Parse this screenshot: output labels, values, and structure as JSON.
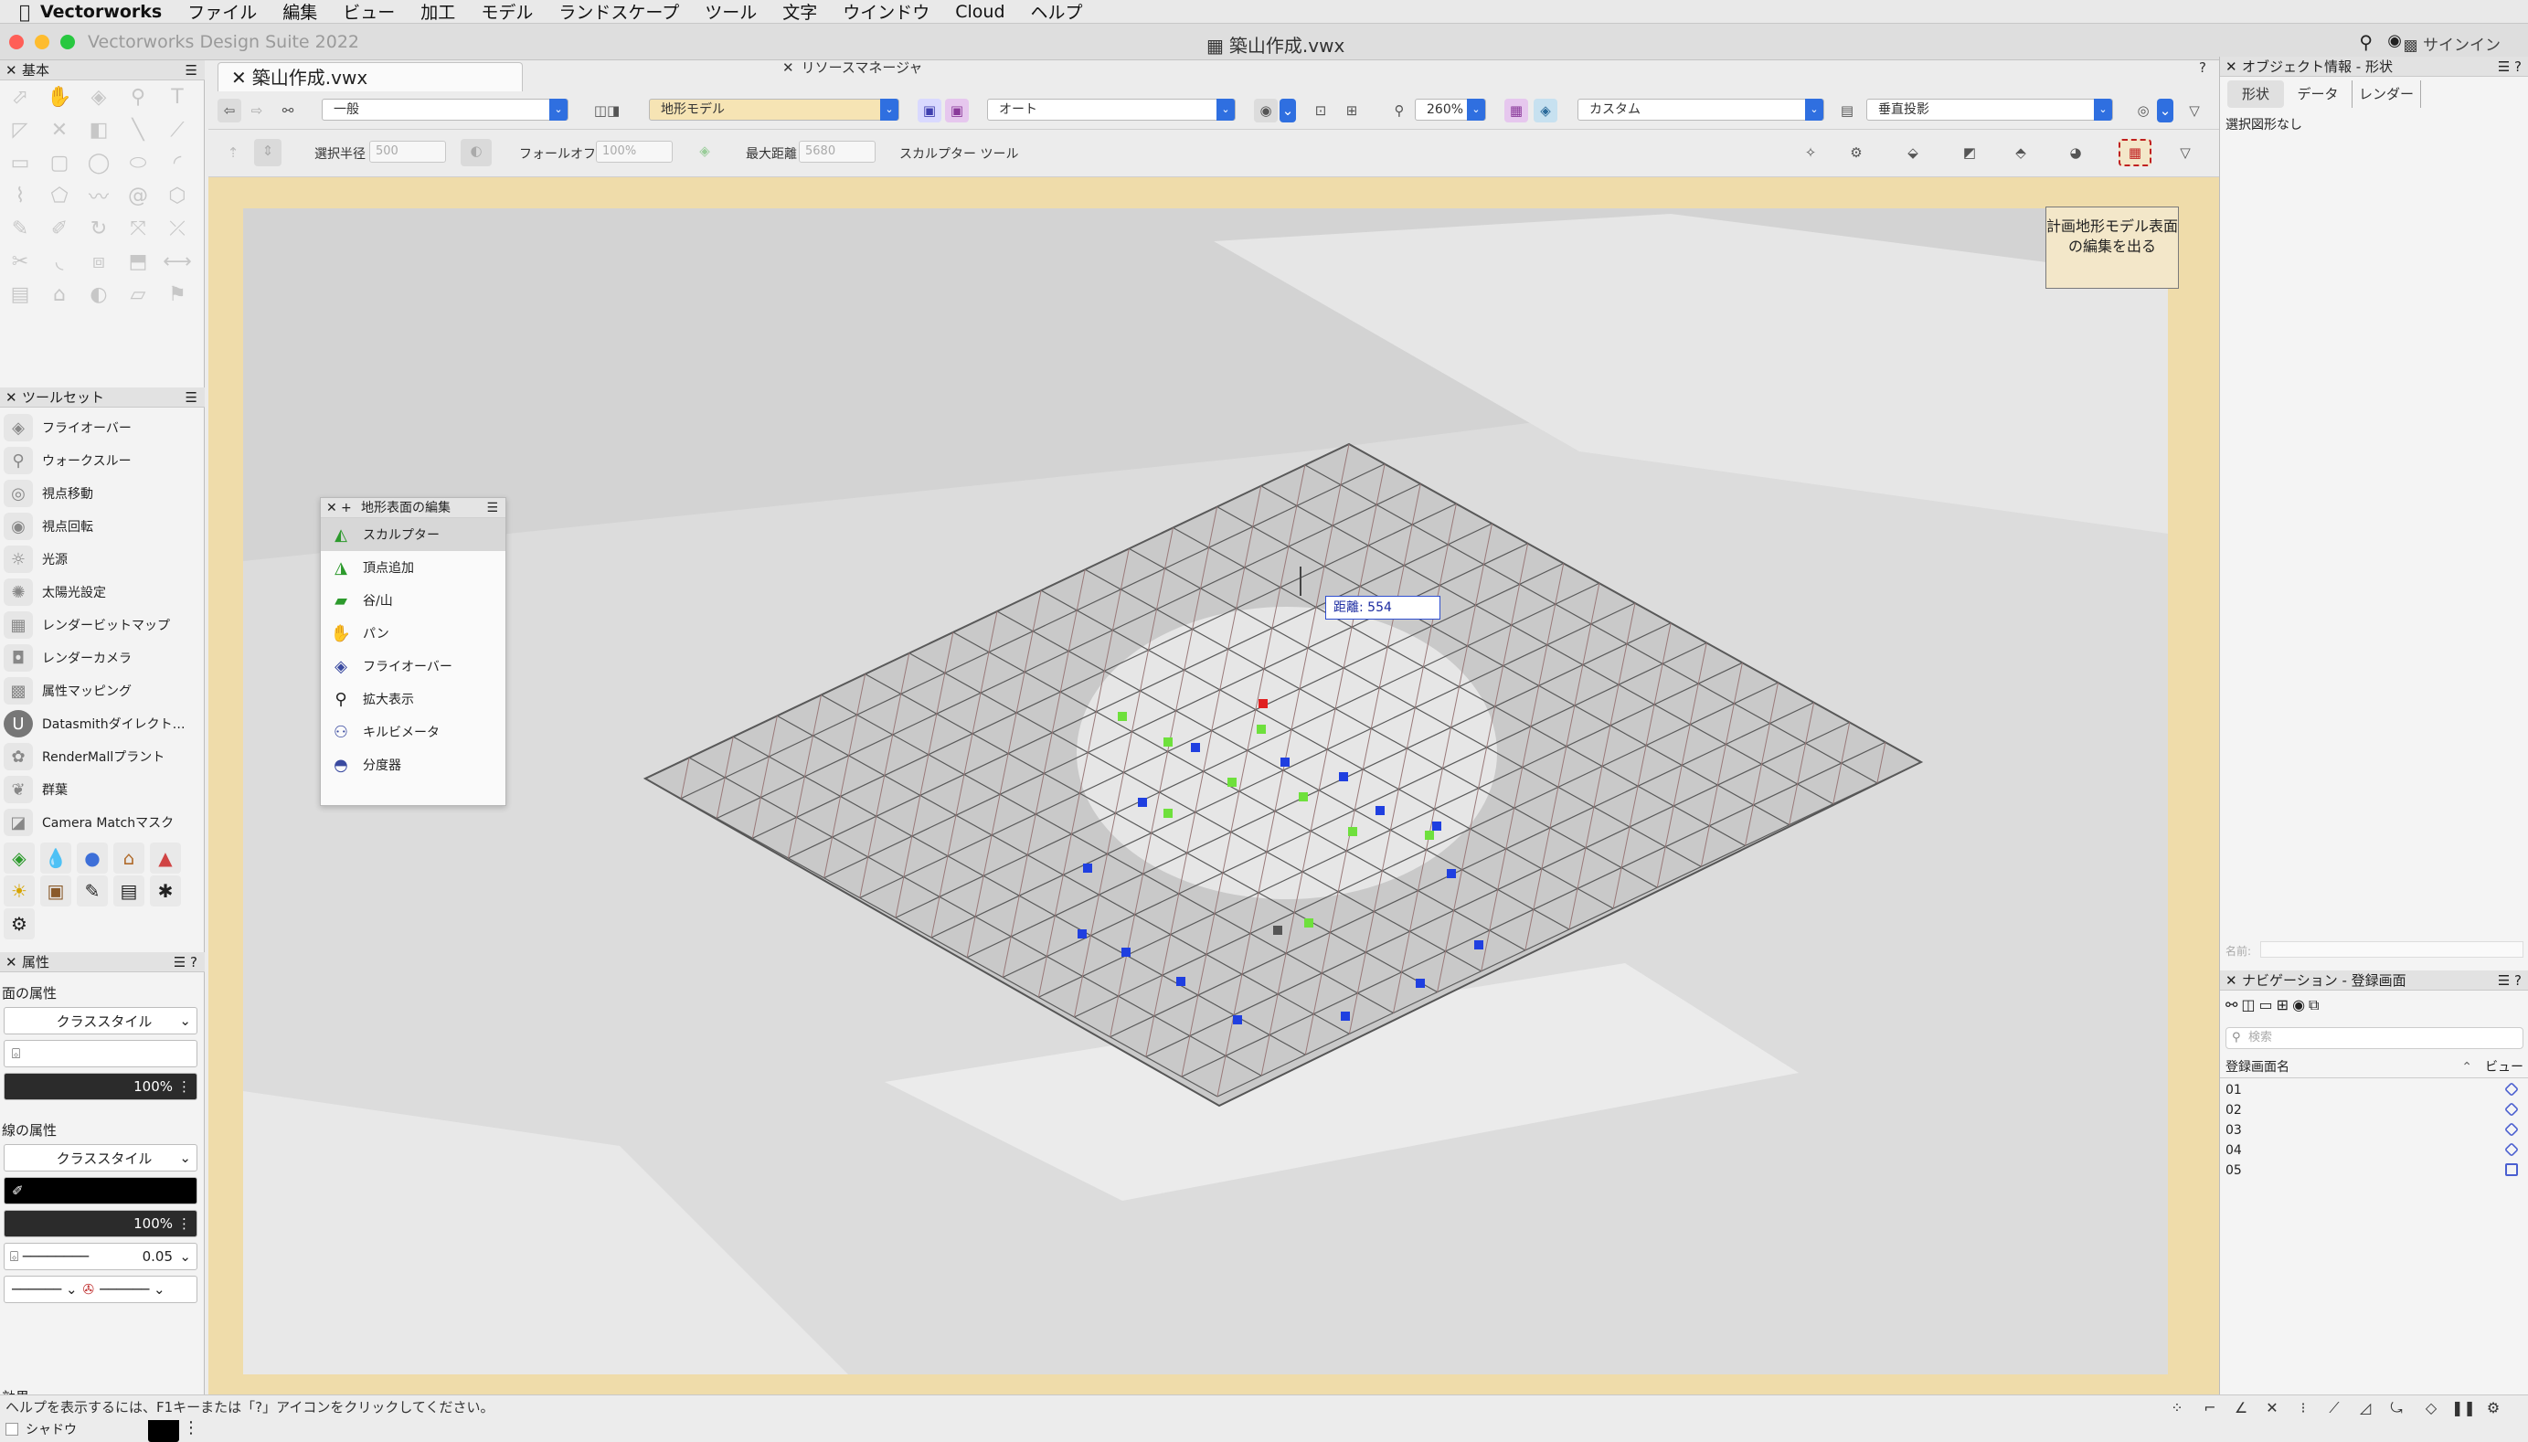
{
  "menubar": {
    "items": [
      "Vectorworks",
      "ファイル",
      "編集",
      "ビュー",
      "加工",
      "モデル",
      "ランドスケープ",
      "ツール",
      "文字",
      "ウインドウ",
      "Cloud",
      "ヘルプ"
    ]
  },
  "titlebar": {
    "app_title": "Vectorworks Design Suite 2022",
    "doc_title": "築山作成.vwx",
    "signin": "サインイン"
  },
  "basic_palette": {
    "title": "基本"
  },
  "toolset_palette": {
    "title": "ツールセット",
    "items": [
      "フライオーバー",
      "ウォークスルー",
      "視点移動",
      "視点回転",
      "光源",
      "太陽光設定",
      "レンダービットマップ",
      "レンダーカメラ",
      "属性マッピング",
      "Datasmithダイレクト…",
      "RenderMallプラント",
      "群葉",
      "Camera Matchマスク"
    ]
  },
  "attributes": {
    "title": "属性",
    "fill_label": "面の属性",
    "fill_style": "クラススタイル",
    "fill_opacity": "100%",
    "line_label": "線の属性",
    "line_style": "クラススタイル",
    "line_opacity": "100%",
    "line_weight": "0.05",
    "effects_label": "効果",
    "shadow_label": "シャドウ"
  },
  "document_tab": "築山作成.vwx",
  "resource_manager": {
    "title": "リソースマネージャ",
    "help": "?"
  },
  "viewbar": {
    "class_drop": "一般",
    "layer_drop": "地形モデル",
    "render_drop": "オート",
    "zoom": "260%",
    "view_drop": "カスタム",
    "projection_drop": "垂直投影"
  },
  "modebar": {
    "select_radius_label": "選択半径",
    "select_radius": "500",
    "falloff_label": "フォールオフ",
    "falloff": "100%",
    "max_distance_label": "最大距離",
    "max_distance": "5680",
    "tool_name": "スカルプター ツール"
  },
  "exit_button": "計画地形モデル表面の編集を出る",
  "distance_readout": {
    "label": "距離:",
    "value": "554"
  },
  "floating_palette": {
    "title": "地形表面の編集",
    "items": [
      "スカルプター",
      "頂点追加",
      "谷/山",
      "パン",
      "フライオーバー",
      "拡大表示",
      "キルビメータ",
      "分度器"
    ]
  },
  "object_info": {
    "title": "オブジェクト情報 - 形状",
    "tabs": [
      "形状",
      "データ",
      "レンダー"
    ],
    "no_selection": "選択図形なし",
    "name_label": "名前:"
  },
  "navigation": {
    "title": "ナビゲーション - 登録画面",
    "search_placeholder": "検索",
    "col_name": "登録画面名",
    "col_view": "ビュー",
    "rows": [
      "01",
      "02",
      "03",
      "04",
      "05"
    ]
  },
  "statusbar": {
    "help_text": "ヘルプを表示するには、F1キーまたは「?」アイコンをクリックしてください。"
  },
  "colors": {
    "accent": "#2f6fe0",
    "sidebar_bg": "#f3f3f3",
    "canvas_bg": "#dddddd",
    "border_highlight": "#efdcaa",
    "vertex_red": "#e02020",
    "vertex_blue": "#1f3fe0",
    "vertex_green": "#6ee03c"
  }
}
